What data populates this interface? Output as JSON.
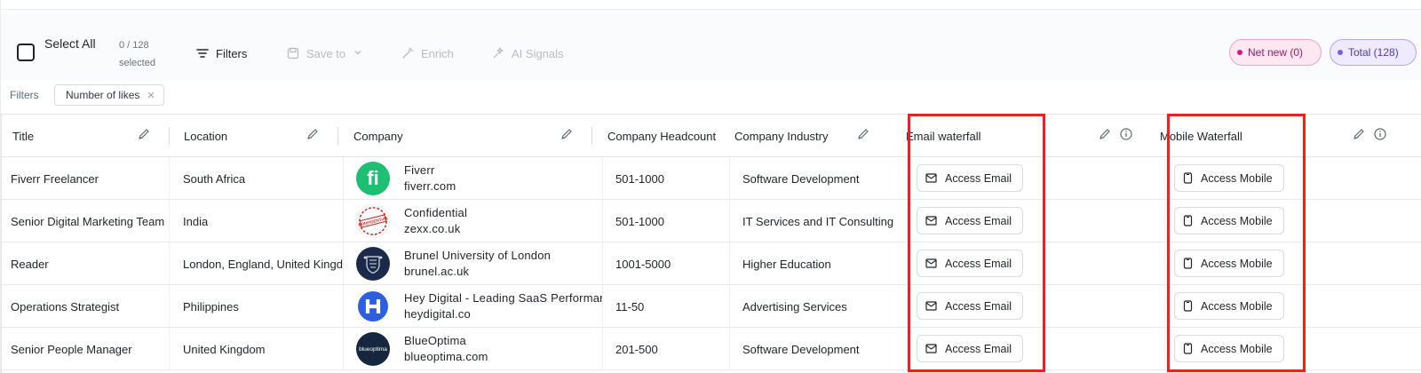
{
  "toolbar": {
    "select_all": "Select All",
    "selected_count": "0 / 128",
    "selected_label": "selected",
    "filters": "Filters",
    "save_to": "Save to",
    "enrich": "Enrich",
    "ai_signals": "AI Signals",
    "net_new": "Net new (0)",
    "total": "Total (128)"
  },
  "filters": {
    "label": "Filters",
    "chips": [
      "Number of likes"
    ]
  },
  "table": {
    "columns": [
      "Title",
      "Location",
      "Company",
      "Company Headcount",
      "Company Industry",
      "Email waterfall",
      "Mobile Waterfall"
    ],
    "rows": [
      {
        "title": "Fiverr Freelancer",
        "location": "South Africa",
        "company": "Fiverr",
        "domain": "fiverr.com",
        "headcount": "501-1000",
        "industry": "Software Development",
        "email_btn": "Access Email",
        "mobile_btn": "Access Mobile"
      },
      {
        "title": "Senior Digital Marketing Team",
        "location": "India",
        "company": "Confidential",
        "domain": "zexx.co.uk",
        "headcount": "501-1000",
        "industry": "IT Services and IT Consulting",
        "email_btn": "Access Email",
        "mobile_btn": "Access Mobile"
      },
      {
        "title": "Reader",
        "location": "London, England, United Kingdom",
        "company": "Brunel University of London",
        "domain": "brunel.ac.uk",
        "headcount": "1001-5000",
        "industry": "Higher Education",
        "email_btn": "Access Email",
        "mobile_btn": "Access Mobile"
      },
      {
        "title": "Operations Strategist",
        "location": "Philippines",
        "company": "Hey Digital - Leading SaaS Performance",
        "domain": "heydigital.co",
        "headcount": "11-50",
        "industry": "Advertising Services",
        "email_btn": "Access Email",
        "mobile_btn": "Access Mobile"
      },
      {
        "title": "Senior People Manager",
        "location": "United Kingdom",
        "company": "BlueOptima",
        "domain": "blueoptima.com",
        "headcount": "201-500",
        "industry": "Software Development",
        "email_btn": "Access Email",
        "mobile_btn": "Access Mobile"
      }
    ]
  },
  "logos": {
    "fiverr": "fi",
    "confidential": "CONFIDENTIAL",
    "blueoptima": "blueoptima"
  },
  "colors": {
    "highlight": "#e8231f",
    "fiverr_green": "#1dbf73",
    "brunel_navy": "#1b2a4a",
    "heydigital_blue": "#2b5fe0",
    "blueoptima_navy": "#16263f"
  }
}
